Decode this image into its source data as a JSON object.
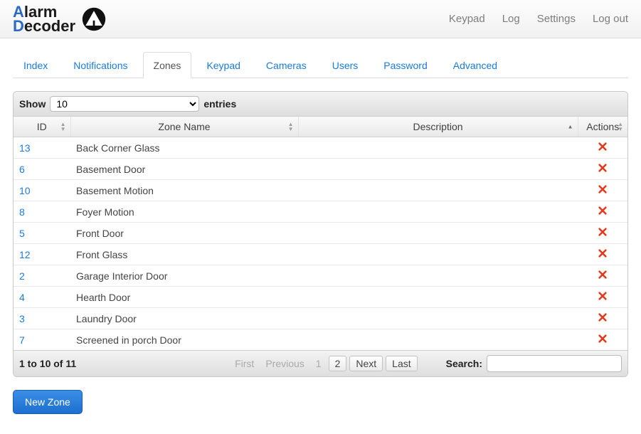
{
  "header": {
    "logo": {
      "line1_prefix": "A",
      "line1_rest": "larm",
      "line2_prefix": "D",
      "line2_rest": "ecoder"
    },
    "nav": {
      "keypad": "Keypad",
      "log": "Log",
      "settings": "Settings",
      "logout": "Log out"
    }
  },
  "tabs": {
    "index": "Index",
    "notifications": "Notifications",
    "zones": "Zones",
    "keypad": "Keypad",
    "cameras": "Cameras",
    "users": "Users",
    "password": "Password",
    "advanced": "Advanced"
  },
  "datatable": {
    "show_label": "Show",
    "entries_label": "entries",
    "page_length": "10",
    "columns": {
      "id": "ID",
      "name": "Zone Name",
      "description": "Description",
      "actions": "Actions"
    },
    "rows": [
      {
        "id": "13",
        "name": "Back Corner Glass",
        "description": ""
      },
      {
        "id": "6",
        "name": "Basement Door",
        "description": ""
      },
      {
        "id": "10",
        "name": "Basement Motion",
        "description": ""
      },
      {
        "id": "8",
        "name": "Foyer Motion",
        "description": ""
      },
      {
        "id": "5",
        "name": "Front Door",
        "description": ""
      },
      {
        "id": "12",
        "name": "Front Glass",
        "description": ""
      },
      {
        "id": "2",
        "name": "Garage Interior Door",
        "description": ""
      },
      {
        "id": "4",
        "name": "Hearth Door",
        "description": ""
      },
      {
        "id": "3",
        "name": "Laundry Door",
        "description": ""
      },
      {
        "id": "7",
        "name": "Screened in porch Door",
        "description": ""
      }
    ],
    "info": "1 to 10 of 11",
    "pager": {
      "first": "First",
      "previous": "Previous",
      "p1": "1",
      "p2": "2",
      "next": "Next",
      "last": "Last"
    },
    "search_label": "Search:",
    "search_value": ""
  },
  "buttons": {
    "new_zone": "New Zone"
  }
}
